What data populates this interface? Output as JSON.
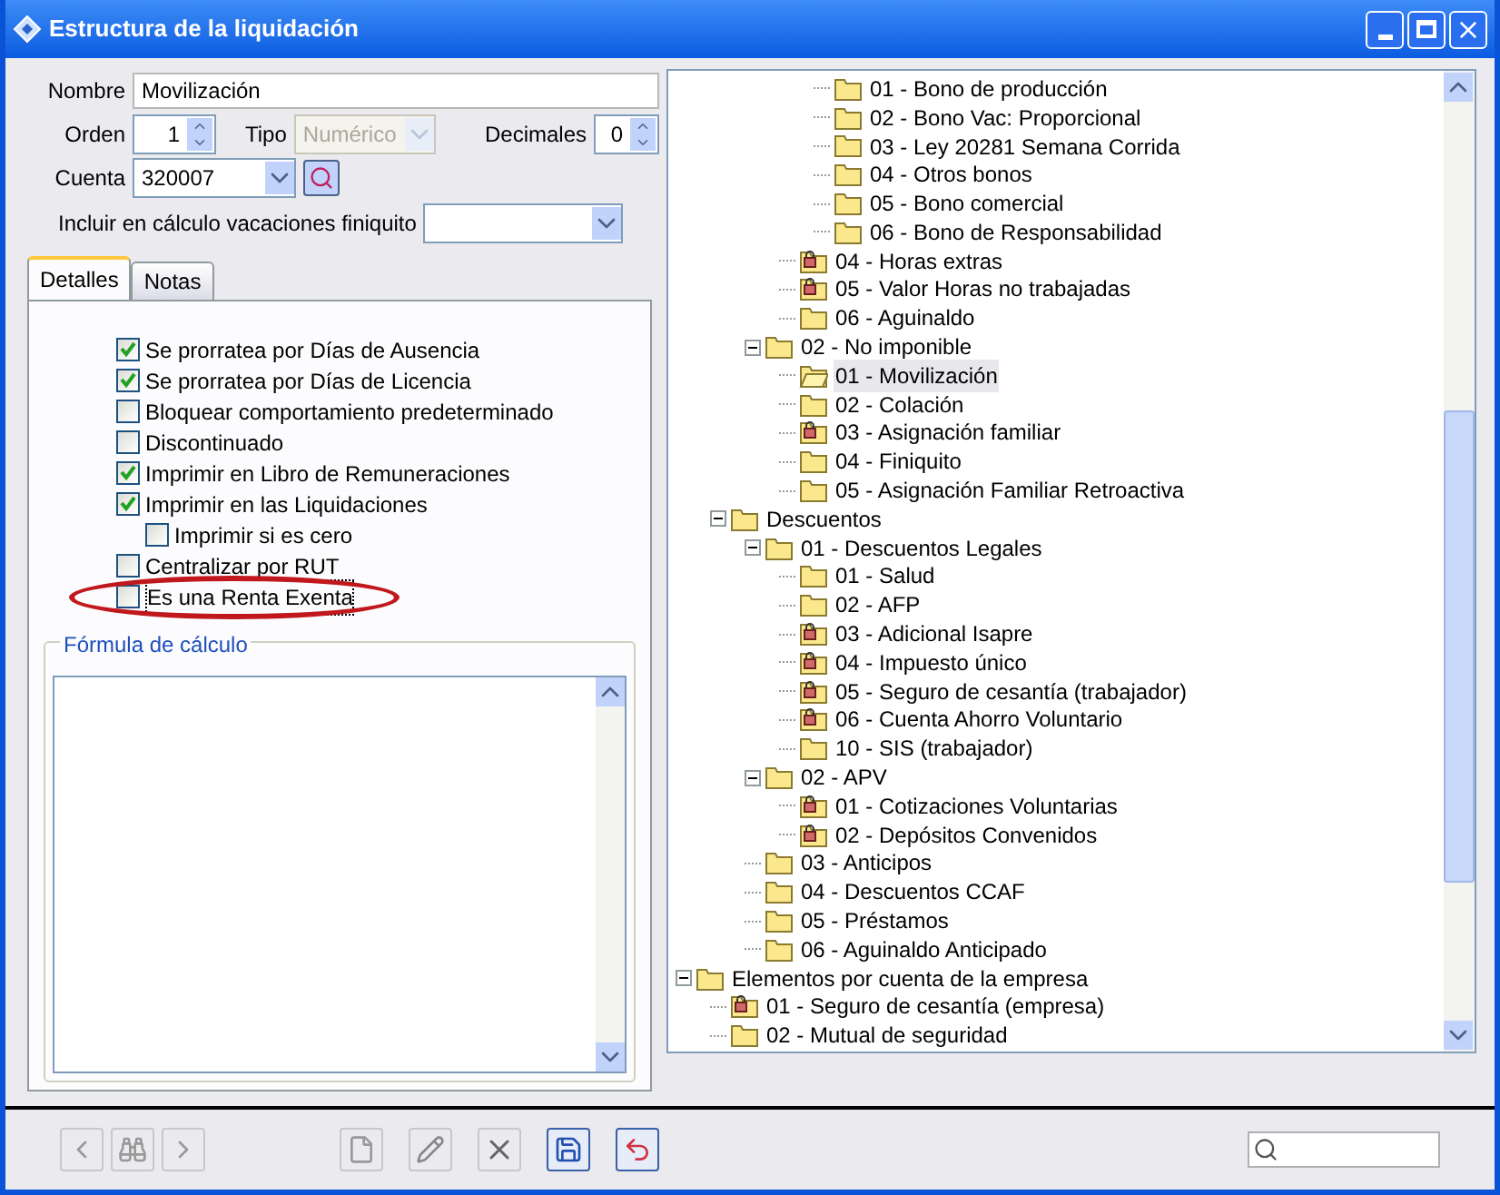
{
  "window": {
    "title": "Estructura de la liquidación"
  },
  "form": {
    "nombre": {
      "label": "Nombre",
      "value": "Movilización"
    },
    "orden": {
      "label": "Orden",
      "value": "1"
    },
    "tipo": {
      "label": "Tipo",
      "value": "Numérico",
      "disabled": true
    },
    "decimales": {
      "label": "Decimales",
      "value": "0"
    },
    "cuenta": {
      "label": "Cuenta",
      "value": "320007"
    },
    "incluir": {
      "label": "Incluir en cálculo vacaciones finiquito"
    }
  },
  "tabs": [
    {
      "label": "Detalles",
      "selected": true
    },
    {
      "label": "Notas",
      "selected": false
    }
  ],
  "options": [
    {
      "label": "Se prorratea por Días de Ausencia",
      "checked": true,
      "highlighted": false
    },
    {
      "label": "Se prorratea por Días de Licencia",
      "checked": true,
      "highlighted": false
    },
    {
      "label": "Bloquear comportamiento predeterminado",
      "checked": false,
      "highlighted": false
    },
    {
      "label": "Discontinuado",
      "checked": false,
      "highlighted": false
    },
    {
      "label": "Imprimir en Libro de Remuneraciones",
      "checked": true,
      "highlighted": false
    },
    {
      "label": "Imprimir en las Liquidaciones",
      "checked": true,
      "highlighted": false,
      "children": [
        {
          "label": "Imprimir si es cero",
          "checked": false,
          "highlighted": false
        }
      ]
    },
    {
      "label": "Centralizar por RUT",
      "checked": false,
      "highlighted": false
    },
    {
      "label": "Es una Renta Exenta",
      "checked": false,
      "highlighted": true
    }
  ],
  "formula": {
    "title": "Fórmula de cálculo"
  },
  "tree": {
    "nodes": [
      {
        "children": [
          {
            "children": [
              {
                "children": [
                  {
                    "children": [
                      {
                        "label": "01 - Bono de producción",
                        "locked": false,
                        "selected": false
                      },
                      {
                        "label": "02 - Bono Vac: Proporcional",
                        "locked": false,
                        "selected": false
                      },
                      {
                        "label": "03 - Ley 20281 Semana Corrida",
                        "locked": false,
                        "selected": false
                      },
                      {
                        "label": "04 - Otros bonos",
                        "locked": false,
                        "selected": false
                      },
                      {
                        "label": "05 - Bono comercial",
                        "locked": false,
                        "selected": false
                      },
                      {
                        "label": "06 - Bono de Responsabilidad",
                        "locked": false,
                        "selected": false
                      }
                    ]
                  },
                  {
                    "label": "04 - Horas extras",
                    "locked": true,
                    "selected": false
                  },
                  {
                    "label": "05 - Valor Horas no trabajadas",
                    "locked": true,
                    "selected": false
                  },
                  {
                    "label": "06 - Aguinaldo",
                    "locked": false,
                    "selected": false
                  }
                ]
              },
              {
                "label": "02 - No imponible",
                "locked": false,
                "selected": false,
                "expanded": true,
                "children": [
                  {
                    "label": "01 - Movilización",
                    "locked": false,
                    "selected": true
                  },
                  {
                    "label": "02 - Colación",
                    "locked": false,
                    "selected": false
                  },
                  {
                    "label": "03 - Asignación familiar",
                    "locked": true,
                    "selected": false
                  },
                  {
                    "label": "04 - Finiquito",
                    "locked": false,
                    "selected": false
                  },
                  {
                    "label": "05 - Asignación Familiar Retroactiva",
                    "locked": false,
                    "selected": false
                  }
                ]
              }
            ]
          },
          {
            "label": "Descuentos",
            "locked": false,
            "selected": false,
            "expanded": true,
            "children": [
              {
                "label": "01 - Descuentos Legales",
                "locked": false,
                "selected": false,
                "expanded": true,
                "children": [
                  {
                    "label": "01 - Salud",
                    "locked": false,
                    "selected": false
                  },
                  {
                    "label": "02 - AFP",
                    "locked": false,
                    "selected": false
                  },
                  {
                    "label": "03 - Adicional Isapre",
                    "locked": true,
                    "selected": false
                  },
                  {
                    "label": "04 - Impuesto único",
                    "locked": true,
                    "selected": false
                  },
                  {
                    "label": "05 - Seguro de cesantía (trabajador)",
                    "locked": true,
                    "selected": false
                  },
                  {
                    "label": "06 - Cuenta Ahorro Voluntario",
                    "locked": true,
                    "selected": false
                  },
                  {
                    "label": "10 - SIS (trabajador)",
                    "locked": false,
                    "selected": false
                  }
                ]
              },
              {
                "label": "02 - APV",
                "locked": false,
                "selected": false,
                "expanded": true,
                "children": [
                  {
                    "label": "01 - Cotizaciones Voluntarias",
                    "locked": true,
                    "selected": false
                  },
                  {
                    "label": "02 - Depósitos Convenidos",
                    "locked": true,
                    "selected": false
                  }
                ]
              },
              {
                "label": "03 - Anticipos",
                "locked": false,
                "selected": false
              },
              {
                "label": "04 - Descuentos CCAF",
                "locked": false,
                "selected": false
              },
              {
                "label": "05 - Préstamos",
                "locked": false,
                "selected": false
              },
              {
                "label": "06 - Aguinaldo Anticipado",
                "locked": false,
                "selected": false
              }
            ]
          }
        ]
      },
      {
        "label": "Elementos por cuenta de la empresa",
        "locked": false,
        "selected": false,
        "expanded": true,
        "children": [
          {
            "label": "01 - Seguro de cesantía (empresa)",
            "locked": true,
            "selected": false
          },
          {
            "label": "02 - Mutual de seguridad",
            "locked": false,
            "selected": false
          }
        ]
      }
    ]
  }
}
